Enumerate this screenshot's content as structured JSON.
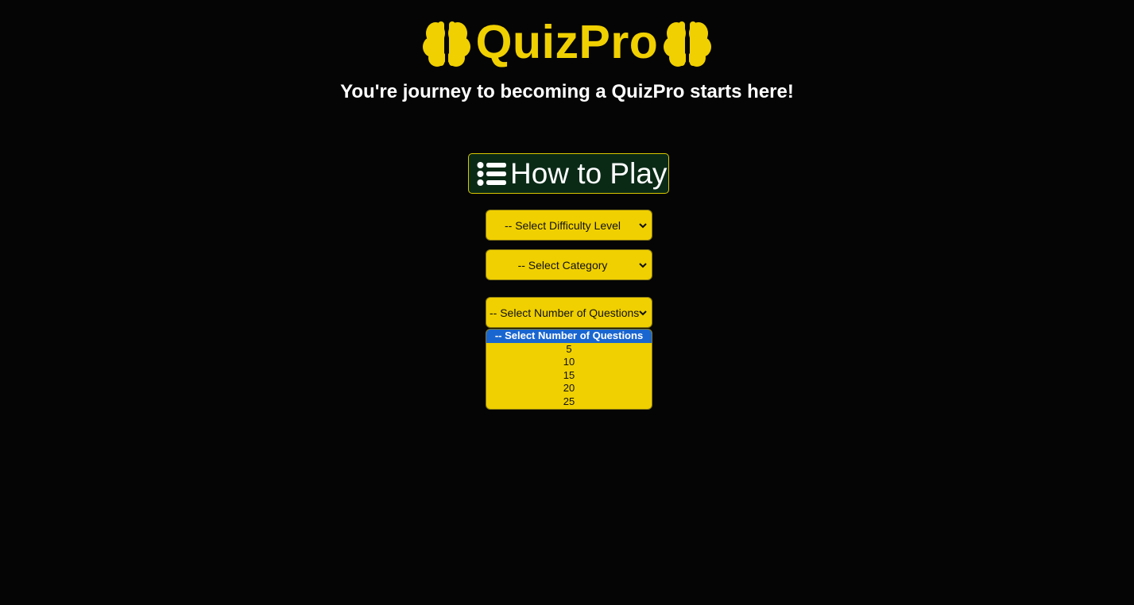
{
  "header": {
    "brand": "QuizPro",
    "left_icon": "brain-icon",
    "right_icon": "brain-icon",
    "tagline": "You're journey to becoming a QuizPro starts here!"
  },
  "how_to_play": {
    "icon": "list-icon",
    "label": "How to Play"
  },
  "selects": {
    "difficulty": {
      "value": "-- Select Difficulty Level"
    },
    "category": {
      "value": "-- Select Category"
    },
    "number_of_questions": {
      "value": "-- Select Number of Questions",
      "expanded": true,
      "options": [
        {
          "label": "-- Select Number of Questions",
          "selected": true
        },
        {
          "label": "5",
          "selected": false
        },
        {
          "label": "10",
          "selected": false
        },
        {
          "label": "15",
          "selected": false
        },
        {
          "label": "20",
          "selected": false
        },
        {
          "label": "25",
          "selected": false
        }
      ]
    }
  },
  "colors": {
    "background": "#050505",
    "accent_yellow": "#f0d000",
    "button_green": "#0a2a16",
    "highlight_blue": "#1a66d0",
    "text_white": "#ffffff"
  }
}
